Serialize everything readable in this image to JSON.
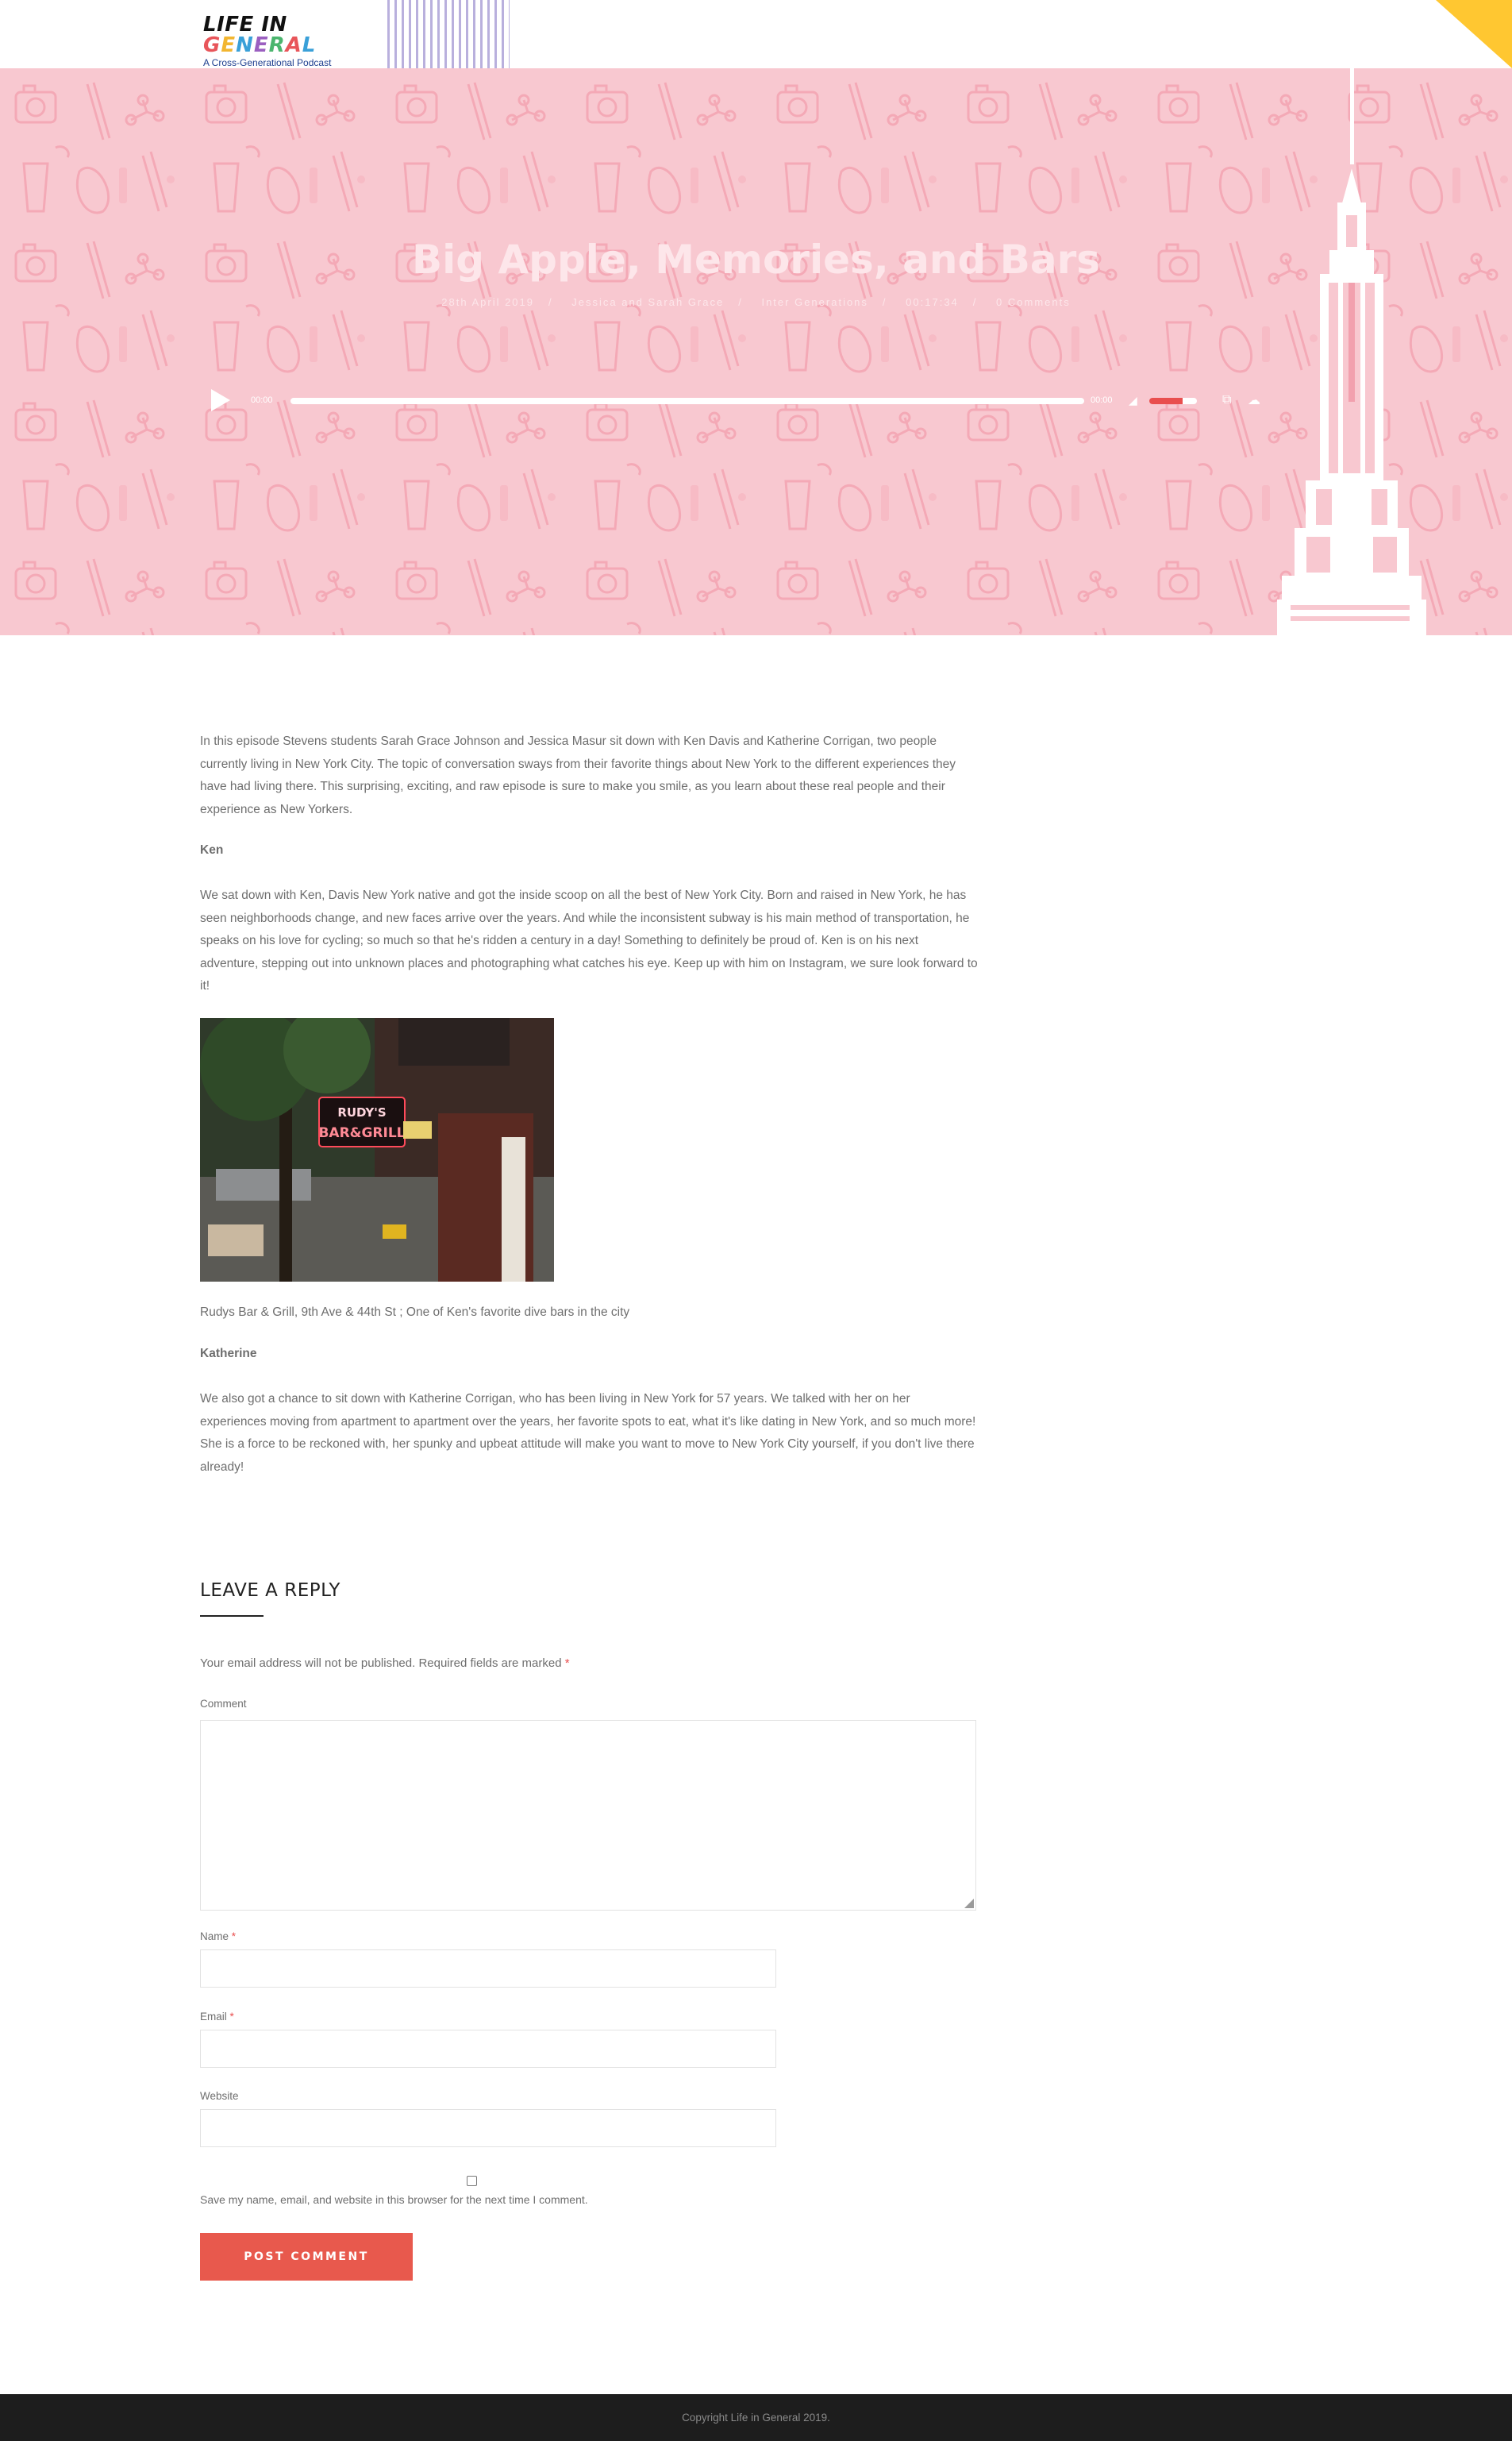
{
  "site": {
    "logo_title": "LIFE IN GENERAL",
    "logo_subtitle": "A Cross-Generational Podcast"
  },
  "colors": {
    "hero_bg": "#f8c8d0",
    "accent_red": "#e8594d",
    "corner_yellow": "#ffc731",
    "stripe_lavender": "#b9b0dd",
    "footer_bg": "#1d1d1d"
  },
  "episode": {
    "title": "Big Apple, Memories, and Bars",
    "meta": [
      "28th April 2019",
      "Jessica and Sarah Grace",
      "Inter Generations",
      "00:17:34",
      "0 Comments"
    ]
  },
  "player": {
    "current_time": "00:00",
    "duration": "00:00",
    "progress_fraction": 0,
    "volume_fraction": 0.7
  },
  "article": {
    "intro": "In this episode Stevens students Sarah Grace Johnson and Jessica Masur sit down with Ken Davis and Katherine Corrigan,  two people currently living in New York City. The topic of conversation sways from their favorite things about New York to the different experiences they have had living there. This surprising, exciting, and raw episode is sure to make you smile, as you learn about these real people and their experience as New Yorkers.",
    "ken_heading": "Ken",
    "ken_text": "We sat down with Ken, Davis New York native and got the inside scoop on all the best of New York City. Born and raised in New York, he has seen neighborhoods change, and new faces arrive over the years. And while the inconsistent subway is his main method of transportation, he speaks on his love for cycling; so much so that he's ridden a century in a day! Something to definitely be proud of. Ken is on his next adventure, stepping out into unknown places and photographing what catches his eye. Keep up with him on Instagram, we sure look forward to it!",
    "photo_sign_top": "RUDY'S",
    "photo_sign_bottom": "BAR&GRILL",
    "caption": "Rudys Bar & Grill, 9th Ave & 44th St ; One of Ken's favorite dive bars in the city",
    "katherine_heading": "Katherine",
    "katherine_text": "We also got a chance to sit down with Katherine Corrigan, who has been living in New York for 57 years. We talked with her on her experiences moving from apartment to apartment over the years, her favorite spots to eat, what it's like dating in New York, and so much more! She is a force to be reckoned with, her spunky and upbeat attitude will make you want to move to New York City yourself, if you don't live there already!"
  },
  "reply": {
    "title": "LEAVE A REPLY",
    "notes": "Your email address will not be published. Required fields are marked",
    "required_mark": "*",
    "comment_label": "Comment",
    "name_label": "Name",
    "email_label": "Email",
    "website_label": "Website",
    "consent": "Save my name, email, and website in this browser for the next time I comment.",
    "submit": "POST COMMENT"
  },
  "footer": {
    "copyright": "Copyright Life in General 2019."
  }
}
